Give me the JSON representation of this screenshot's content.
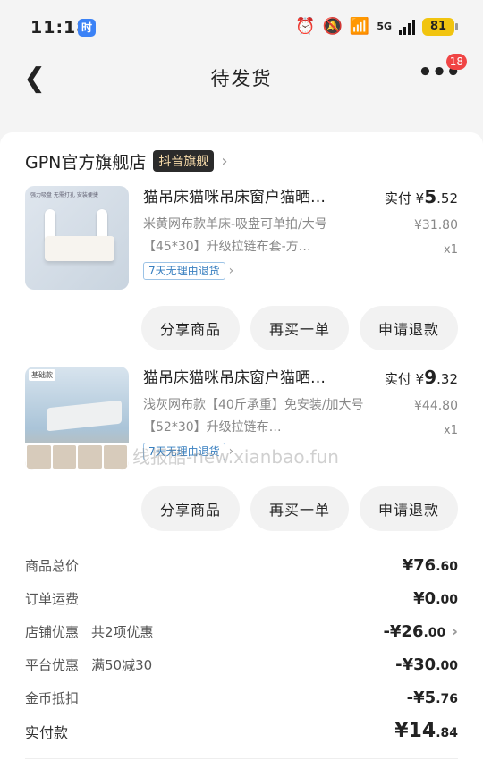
{
  "status": {
    "time": "11:18",
    "carrier_badge": "时",
    "network": "5G",
    "battery": "81"
  },
  "nav": {
    "title": "待发货",
    "more_badge": "18"
  },
  "shop": {
    "name": "GPN官方旗舰店",
    "tag": "抖音旗舰"
  },
  "items": [
    {
      "title": "猫吊床猫咪吊床窗户猫晒…",
      "spec": "米黄网布款单床-吸盘可单拍/大号【45*30】升级拉链布套-方…",
      "tag": "7天无理由退货",
      "paid_label": "实付",
      "paid_currency": "¥",
      "paid_int": "5",
      "paid_dec": ".52",
      "orig_price": "¥31.80",
      "qty": "x1",
      "thumb_caption": "强力吸盘 无需打孔 安装便捷"
    },
    {
      "title": "猫吊床猫咪吊床窗户猫晒…",
      "spec": "浅灰网布款【40斤承重】免安装/加大号【52*30】升级拉链布…",
      "tag": "7天无理由退货",
      "paid_label": "实付",
      "paid_currency": "¥",
      "paid_int": "9",
      "paid_dec": ".32",
      "orig_price": "¥44.80",
      "qty": "x1",
      "thumb_caption": "基础款"
    }
  ],
  "buttons": {
    "share": "分享商品",
    "rebuy": "再买一单",
    "refund": "申请退款"
  },
  "summary": {
    "goods_total_label": "商品总价",
    "goods_total_int": "¥76",
    "goods_total_dec": ".60",
    "shipping_label": "订单运费",
    "shipping_int": "¥0",
    "shipping_dec": ".00",
    "shop_discount_label": "店铺优惠",
    "shop_discount_note": "共2项优惠",
    "shop_discount_int": "-¥26",
    "shop_discount_dec": ".00",
    "platform_discount_label": "平台优惠",
    "platform_discount_note": "满50减30",
    "platform_discount_int": "-¥30",
    "platform_discount_dec": ".00",
    "coins_label": "金币抵扣",
    "coins_int": "-¥5",
    "coins_dec": ".76",
    "paid_total_label": "实付款",
    "paid_total_int": "¥14",
    "paid_total_dec": ".84"
  },
  "watermark": "线报酷-new.xianbao.fun",
  "colors": {
    "refund_tag": "#3a80c0",
    "badge": "#f04545",
    "shop_tag_bg": "#2b2b2b",
    "battery": "#f1c40f"
  }
}
